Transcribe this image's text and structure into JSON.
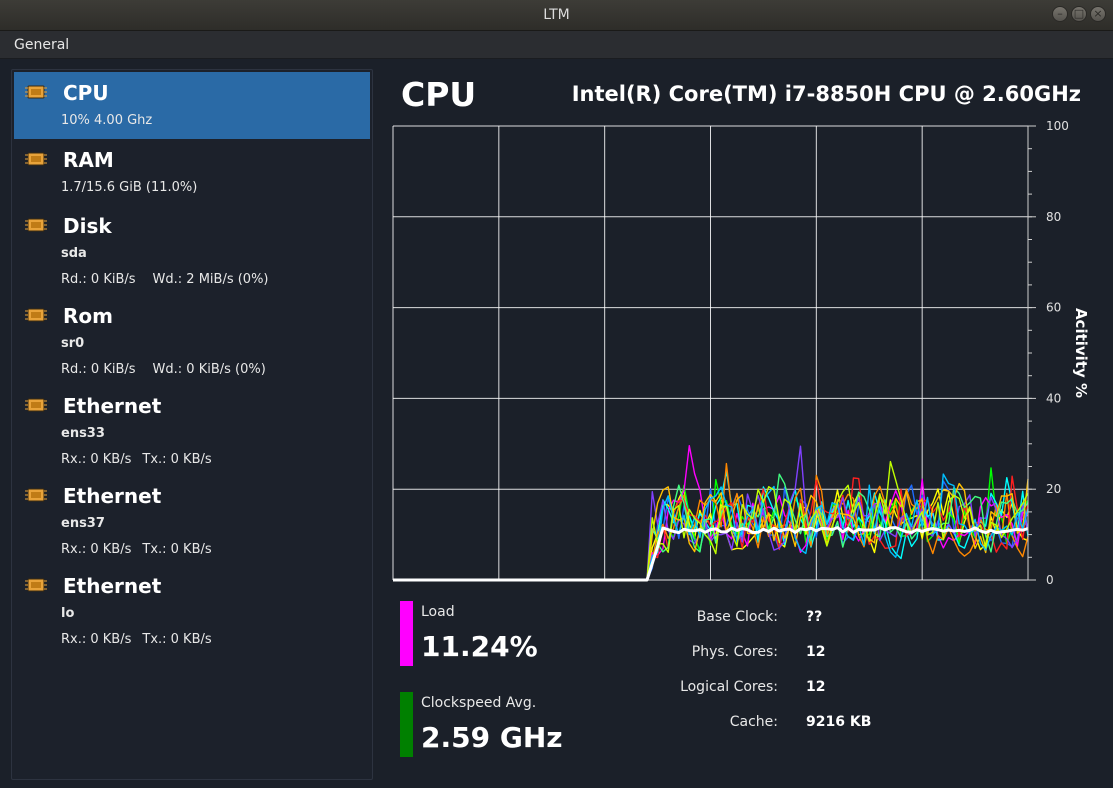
{
  "window": {
    "title": "LTM"
  },
  "menu": {
    "items": [
      "General"
    ]
  },
  "sidebar": {
    "items": [
      {
        "name": "CPU",
        "line1": "10%  4.00 Ghz",
        "line1_bold": false,
        "line2": null,
        "selected": true
      },
      {
        "name": "RAM",
        "line1": "1.7/15.6 GiB (11.0%)",
        "line1_bold": false,
        "line2": null,
        "selected": false
      },
      {
        "name": "Disk",
        "line1": "sda",
        "line1_bold": true,
        "line2a": "Rd.: 0 KiB/s",
        "line2b": "Wd.: 2 MiB/s (0%)",
        "selected": false
      },
      {
        "name": "Rom",
        "line1": "sr0",
        "line1_bold": true,
        "line2a": "Rd.: 0 KiB/s",
        "line2b": "Wd.: 0 KiB/s (0%)",
        "selected": false
      },
      {
        "name": "Ethernet",
        "line1": "ens33",
        "line1_bold": true,
        "line2a": "Rx.: 0 KB/s",
        "line2b": "Tx.: 0 KB/s",
        "selected": false
      },
      {
        "name": "Ethernet",
        "line1": "ens37",
        "line1_bold": true,
        "line2a": "Rx.: 0 KB/s",
        "line2b": "Tx.: 0 KB/s",
        "selected": false
      },
      {
        "name": "Ethernet",
        "line1": "lo",
        "line1_bold": true,
        "line2a": "Rx.: 0 KB/s",
        "line2b": "Tx.: 0 KB/s",
        "selected": false
      }
    ]
  },
  "main": {
    "title": "CPU",
    "model": "Intel(R) Core(TM) i7-8850H CPU @ 2.60GHz",
    "load": {
      "label": "Load",
      "value": "11.24%",
      "color": "#ff00ff"
    },
    "clock": {
      "label": "Clockspeed Avg.",
      "value": "2.59 GHz",
      "color": "#008000"
    },
    "info": [
      {
        "label": "Base Clock:",
        "value": "??"
      },
      {
        "label": "Phys. Cores:",
        "value": "12"
      },
      {
        "label": "Logical Cores:",
        "value": "12"
      },
      {
        "label": "Cache:",
        "value": "9216 KB"
      }
    ]
  },
  "chart_data": {
    "type": "line",
    "ylabel": "Acitivity %",
    "ylim": [
      0,
      100
    ],
    "yticks": [
      "0",
      "20",
      "40",
      "60",
      "80",
      "100"
    ],
    "grid": true,
    "series_colors": [
      "#1e6cff",
      "#ffff00",
      "#00ff00",
      "#ff00ff",
      "#00ffff",
      "#ff8800",
      "#ff2020",
      "#8040ff",
      "#40ff80",
      "#ffc000",
      "#00c0ff",
      "#c0ff00"
    ],
    "average_color": "#ffffff",
    "activity_start_fraction": 0.4,
    "idle_level": 0,
    "average_level": 11
  }
}
